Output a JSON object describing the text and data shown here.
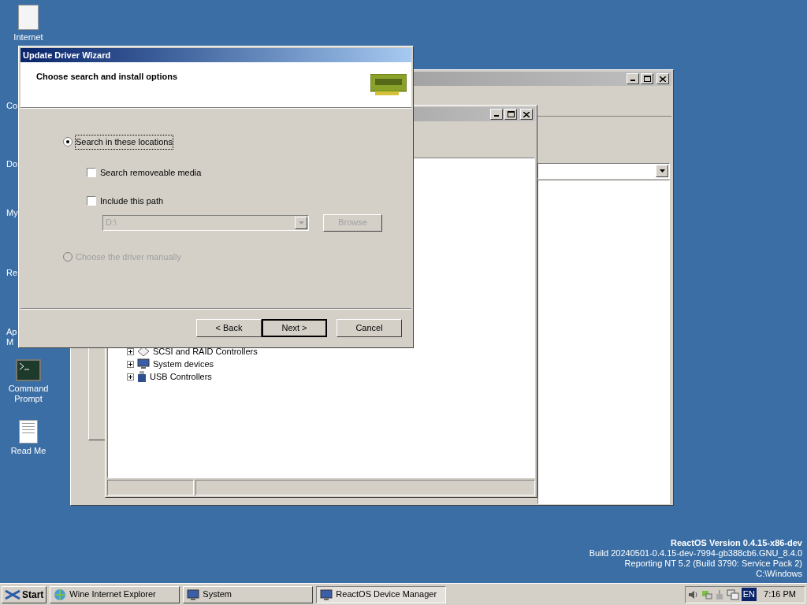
{
  "desktop": {
    "icons": [
      {
        "label": "Internet",
        "kind": "page"
      },
      {
        "label": "Command Prompt",
        "kind": "terminal"
      },
      {
        "label": "Read Me",
        "kind": "document"
      }
    ],
    "label_fragments": [
      "Co",
      "Do",
      "My",
      "Re",
      "Ap",
      "M"
    ]
  },
  "system_window": {
    "active": false
  },
  "device_manager": {
    "active": false,
    "tree": [
      {
        "label": "SCSI and RAID Controllers",
        "kind": "controller",
        "expanded": false
      },
      {
        "label": "System devices",
        "kind": "computer",
        "expanded": false
      },
      {
        "label": "USB Controllers",
        "kind": "usb",
        "expanded": false
      }
    ]
  },
  "wizard": {
    "title": "Update Driver Wizard",
    "active": true,
    "header_title": "Choose search and install options",
    "radio_search": {
      "label": "Search in these locations",
      "selected": true,
      "disabled": false
    },
    "checkboxes": [
      {
        "label": "Search removeable media",
        "checked": false
      },
      {
        "label": "Include this path",
        "checked": false
      }
    ],
    "path_combo": {
      "value": "D:\\",
      "disabled": true
    },
    "browse_button": {
      "label": "Browse",
      "disabled": true
    },
    "radio_manual": {
      "label": "Choose the driver manually",
      "selected": false,
      "disabled": true
    },
    "buttons": [
      {
        "label": "< Back",
        "default": false
      },
      {
        "label": "Next >",
        "default": true
      },
      {
        "label": "Cancel",
        "default": false
      }
    ]
  },
  "version_info": [
    "ReactOS Version 0.4.15-x86-dev",
    "Build 20240501-0.4.15-dev-7994-gb388cb6.GNU_8.4.0",
    "Reporting NT 5.2 (Build 3790: Service Pack 2)",
    "C:\\Windows"
  ],
  "taskbar": {
    "start": "Start",
    "tasks": [
      {
        "label": "Wine Internet Explorer",
        "kind": "browser",
        "selected": false
      },
      {
        "label": "System",
        "kind": "monitor",
        "selected": false
      },
      {
        "label": "ReactOS Device Manager",
        "kind": "monitor",
        "selected": true
      }
    ],
    "tray": {
      "language": "EN",
      "time": "7:16 PM"
    }
  }
}
